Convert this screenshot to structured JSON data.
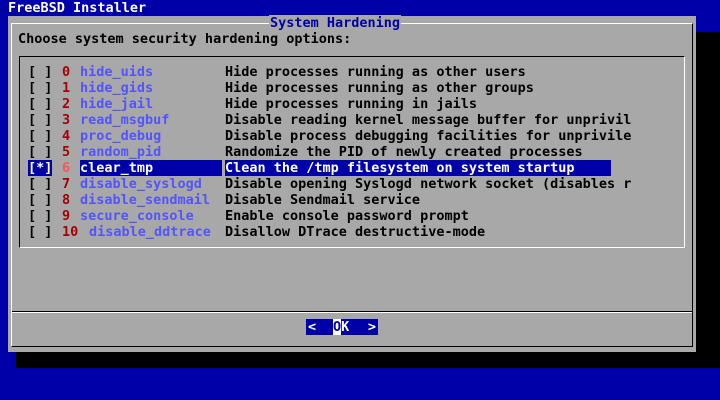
{
  "app": {
    "title": "FreeBSD Installer"
  },
  "dialog": {
    "title": "System Hardening",
    "prompt": "Choose system security hardening options:",
    "ok_left": "<",
    "ok_hotkey": "O",
    "ok_rest": "K",
    "ok_right": ">"
  },
  "options": [
    {
      "check": "[ ]",
      "index": "0",
      "name": "hide_uids",
      "desc": "Hide processes running as other users"
    },
    {
      "check": "[ ]",
      "index": "1",
      "name": "hide_gids",
      "desc": "Hide processes running as other groups"
    },
    {
      "check": "[ ]",
      "index": "2",
      "name": "hide_jail",
      "desc": "Hide processes running in jails"
    },
    {
      "check": "[ ]",
      "index": "3",
      "name": "read_msgbuf",
      "desc": "Disable reading kernel message buffer for unprivil"
    },
    {
      "check": "[ ]",
      "index": "4",
      "name": "proc_debug",
      "desc": "Disable process debugging facilities for unprivile"
    },
    {
      "check": "[ ]",
      "index": "5",
      "name": "random_pid",
      "desc": "Randomize the PID of newly created processes"
    },
    {
      "check": "[*]",
      "index": "6",
      "name": "clear_tmp",
      "desc": "Clean the /tmp filesystem on system startup"
    },
    {
      "check": "[ ]",
      "index": "7",
      "name": "disable_syslogd",
      "desc": "Disable opening Syslogd network socket (disables r"
    },
    {
      "check": "[ ]",
      "index": "8",
      "name": "disable_sendmail",
      "desc": "Disable Sendmail service"
    },
    {
      "check": "[ ]",
      "index": "9",
      "name": "secure_console",
      "desc": "Enable console password prompt"
    },
    {
      "check": "[ ]",
      "index": "10",
      "name": "disable_ddtrace",
      "desc": "Disallow DTrace destructive-mode"
    }
  ],
  "colors": {
    "background": "#0000a8",
    "dialog": "#a8a8a8",
    "index": "#a80000",
    "name": "#5454fc",
    "selected_bg": "#0000a8",
    "selected_fg": "#ffffff"
  }
}
